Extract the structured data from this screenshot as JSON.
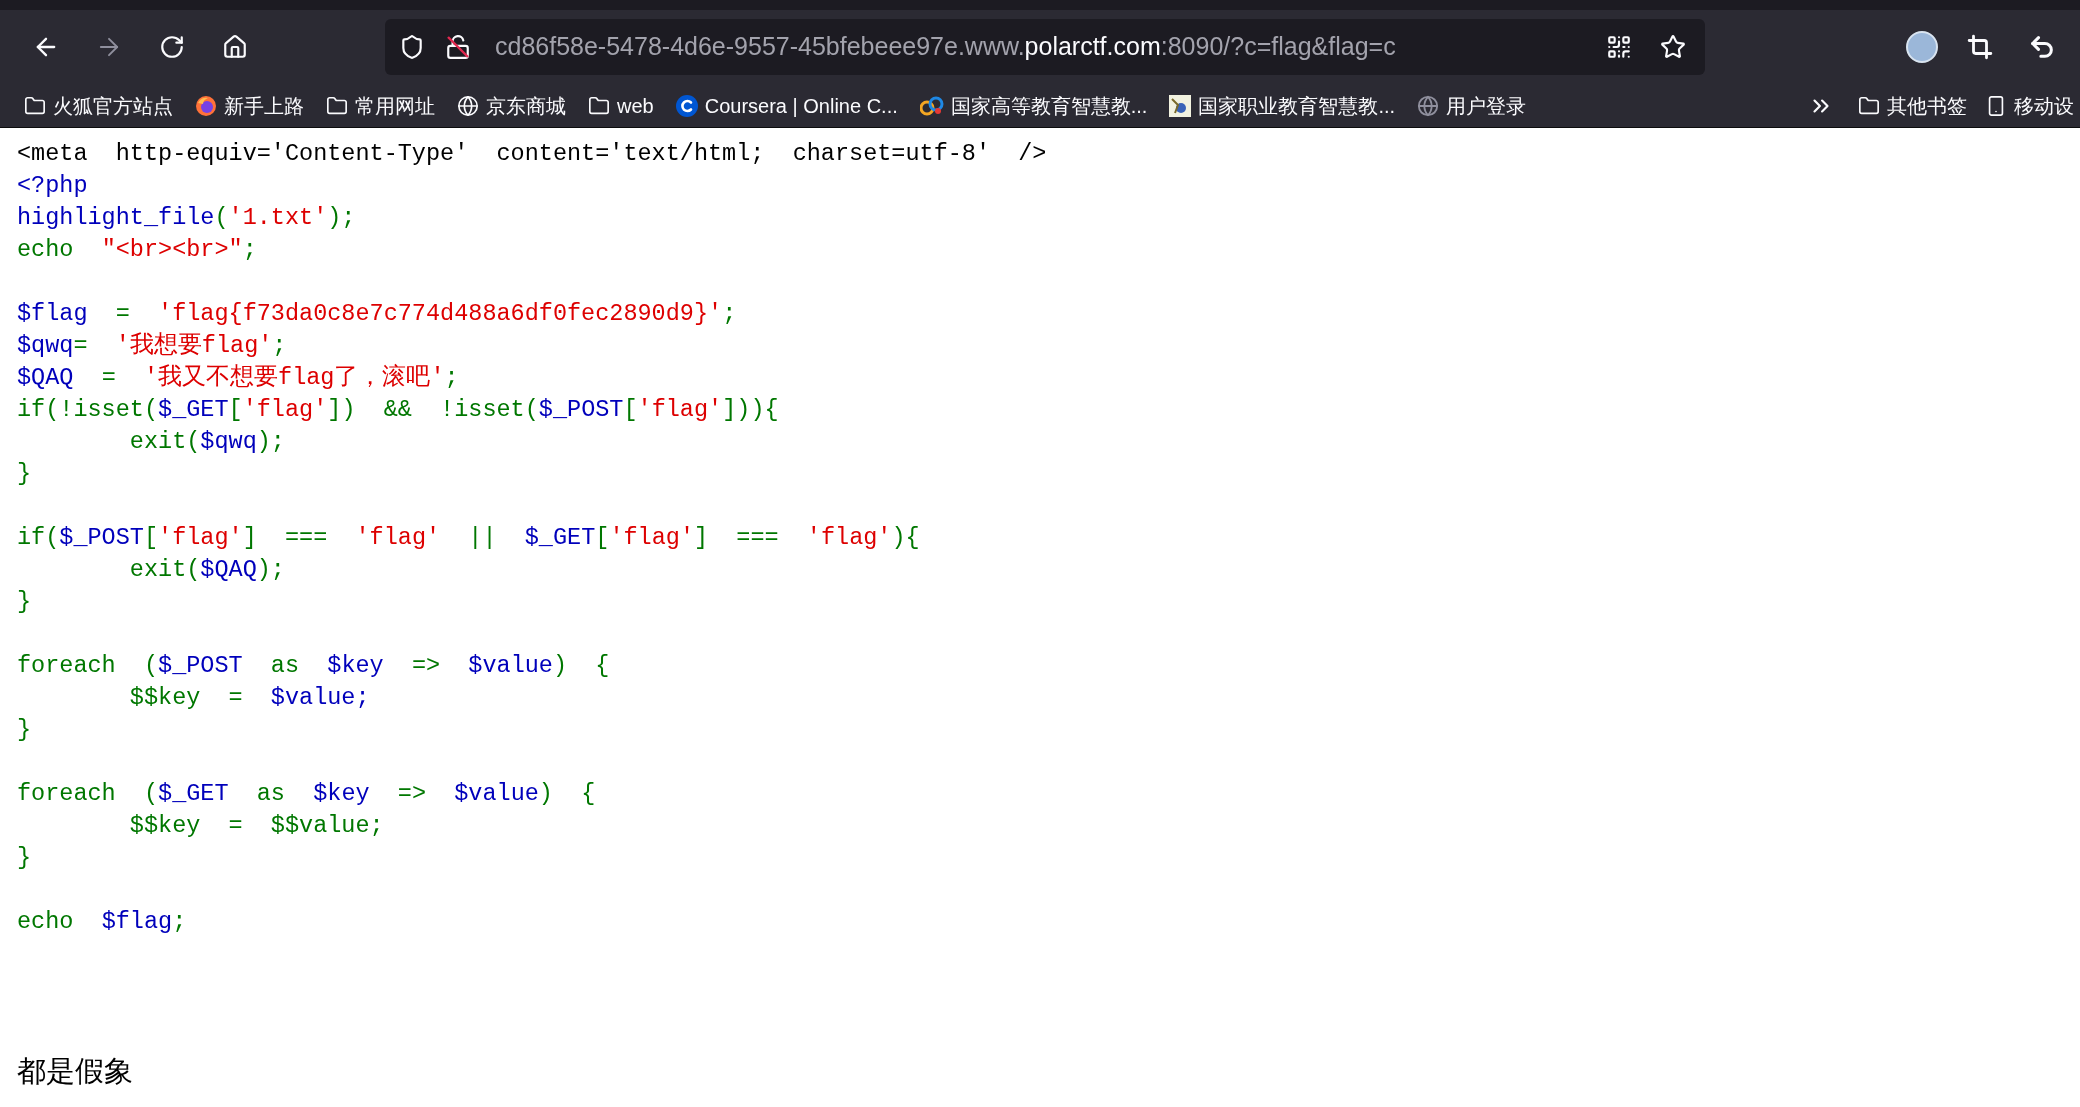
{
  "toolbar": {
    "url_parts": [
      {
        "text": "cd86f58e-5478-4d6e-9557-45bfebeee97e.www.",
        "emphasized": false
      },
      {
        "text": "polarctf.com",
        "emphasized": true
      },
      {
        "text": ":8090/?c=flag&flag=c",
        "emphasized": false
      }
    ]
  },
  "bookmarks": [
    {
      "label": "火狐官方站点",
      "kind": "folder"
    },
    {
      "label": "新手上路",
      "kind": "firefox"
    },
    {
      "label": "常用网址",
      "kind": "folder"
    },
    {
      "label": "京东商城",
      "kind": "globe"
    },
    {
      "label": "web",
      "kind": "folder"
    },
    {
      "label": "Coursera | Online C...",
      "kind": "coursera"
    },
    {
      "label": "国家高等教育智慧教...",
      "kind": "logo"
    },
    {
      "label": "国家职业教育智慧教...",
      "kind": "image"
    },
    {
      "label": "用户登录",
      "kind": "site"
    }
  ],
  "bookmarks_right": [
    {
      "label": "其他书签",
      "kind": "folder"
    },
    {
      "label": "移动设",
      "kind": "mobile"
    }
  ],
  "code_lines": [
    {
      "kind": "code",
      "tokens": [
        {
          "text": "<meta  http-equiv='Content-Type'  content='text/html;  charset=utf-8'  />",
          "color": "#000000"
        }
      ]
    },
    {
      "kind": "code",
      "tokens": [
        {
          "text": "<?php",
          "color": "#0000bb"
        }
      ]
    },
    {
      "kind": "code",
      "tokens": [
        {
          "text": "highlight_file",
          "color": "#0000bb"
        },
        {
          "text": "(",
          "color": "#007700"
        },
        {
          "text": "'1.txt'",
          "color": "#dd0000"
        },
        {
          "text": ");",
          "color": "#007700"
        }
      ]
    },
    {
      "kind": "code",
      "tokens": [
        {
          "text": "echo  ",
          "color": "#007700"
        },
        {
          "text": "\"<br><br>\"",
          "color": "#dd0000"
        },
        {
          "text": ";",
          "color": "#007700"
        }
      ]
    },
    {
      "kind": "blank"
    },
    {
      "kind": "code",
      "tokens": [
        {
          "text": "$flag  ",
          "color": "#0000bb"
        },
        {
          "text": "=  ",
          "color": "#007700"
        },
        {
          "text": "'flag{f73da0c8e7c774d488a6df0fec2890d9}'",
          "color": "#dd0000"
        },
        {
          "text": ";",
          "color": "#007700"
        }
      ]
    },
    {
      "kind": "code",
      "tokens": [
        {
          "text": "$qwq",
          "color": "#0000bb"
        },
        {
          "text": "=  ",
          "color": "#007700"
        },
        {
          "text": "'我想要flag'",
          "color": "#dd0000"
        },
        {
          "text": ";",
          "color": "#007700"
        }
      ]
    },
    {
      "kind": "code",
      "tokens": [
        {
          "text": "$QAQ  ",
          "color": "#0000bb"
        },
        {
          "text": "=  ",
          "color": "#007700"
        },
        {
          "text": "'我又不想要flag了，滚吧'",
          "color": "#dd0000"
        },
        {
          "text": ";",
          "color": "#007700"
        }
      ]
    },
    {
      "kind": "code",
      "tokens": [
        {
          "text": "if(!isset(",
          "color": "#007700"
        },
        {
          "text": "$_GET",
          "color": "#0000bb"
        },
        {
          "text": "[",
          "color": "#007700"
        },
        {
          "text": "'flag'",
          "color": "#dd0000"
        },
        {
          "text": "])  &&  !isset(",
          "color": "#007700"
        },
        {
          "text": "$_POST",
          "color": "#0000bb"
        },
        {
          "text": "[",
          "color": "#007700"
        },
        {
          "text": "'flag'",
          "color": "#dd0000"
        },
        {
          "text": "])){",
          "color": "#007700"
        }
      ]
    },
    {
      "kind": "code",
      "tokens": [
        {
          "text": "        exit(",
          "color": "#007700"
        },
        {
          "text": "$qwq",
          "color": "#0000bb"
        },
        {
          "text": ");",
          "color": "#007700"
        }
      ]
    },
    {
      "kind": "code",
      "tokens": [
        {
          "text": "}",
          "color": "#007700"
        }
      ]
    },
    {
      "kind": "blank"
    },
    {
      "kind": "code",
      "tokens": [
        {
          "text": "if(",
          "color": "#007700"
        },
        {
          "text": "$_POST",
          "color": "#0000bb"
        },
        {
          "text": "[",
          "color": "#007700"
        },
        {
          "text": "'flag'",
          "color": "#dd0000"
        },
        {
          "text": "]  ===  ",
          "color": "#007700"
        },
        {
          "text": "'flag'",
          "color": "#dd0000"
        },
        {
          "text": "  ||  ",
          "color": "#007700"
        },
        {
          "text": "$_GET",
          "color": "#0000bb"
        },
        {
          "text": "[",
          "color": "#007700"
        },
        {
          "text": "'flag'",
          "color": "#dd0000"
        },
        {
          "text": "]  ===  ",
          "color": "#007700"
        },
        {
          "text": "'flag'",
          "color": "#dd0000"
        },
        {
          "text": "){",
          "color": "#007700"
        }
      ]
    },
    {
      "kind": "code",
      "tokens": [
        {
          "text": "        exit(",
          "color": "#007700"
        },
        {
          "text": "$QAQ",
          "color": "#0000bb"
        },
        {
          "text": ");",
          "color": "#007700"
        }
      ]
    },
    {
      "kind": "code",
      "tokens": [
        {
          "text": "}",
          "color": "#007700"
        }
      ]
    },
    {
      "kind": "blank"
    },
    {
      "kind": "code",
      "tokens": [
        {
          "text": "foreach  (",
          "color": "#007700"
        },
        {
          "text": "$_POST  ",
          "color": "#0000bb"
        },
        {
          "text": "as  ",
          "color": "#007700"
        },
        {
          "text": "$key  ",
          "color": "#0000bb"
        },
        {
          "text": "=>  ",
          "color": "#007700"
        },
        {
          "text": "$value",
          "color": "#0000bb"
        },
        {
          "text": ")  {",
          "color": "#007700"
        }
      ]
    },
    {
      "kind": "code",
      "tokens": [
        {
          "text": "        $$key  =  ",
          "color": "#007700"
        },
        {
          "text": "$value;",
          "color": "#0000bb"
        }
      ]
    },
    {
      "kind": "code",
      "tokens": [
        {
          "text": "}",
          "color": "#007700"
        }
      ]
    },
    {
      "kind": "blank"
    },
    {
      "kind": "code",
      "tokens": [
        {
          "text": "foreach  (",
          "color": "#007700"
        },
        {
          "text": "$_GET  ",
          "color": "#0000bb"
        },
        {
          "text": "as  ",
          "color": "#007700"
        },
        {
          "text": "$key  ",
          "color": "#0000bb"
        },
        {
          "text": "=>  ",
          "color": "#007700"
        },
        {
          "text": "$value",
          "color": "#0000bb"
        },
        {
          "text": ")  {",
          "color": "#007700"
        }
      ]
    },
    {
      "kind": "code",
      "tokens": [
        {
          "text": "        $$key  =  $$value;",
          "color": "#007700"
        }
      ]
    },
    {
      "kind": "code",
      "tokens": [
        {
          "text": "}",
          "color": "#007700"
        }
      ]
    },
    {
      "kind": "blank"
    },
    {
      "kind": "code",
      "tokens": [
        {
          "text": "echo  ",
          "color": "#007700"
        },
        {
          "text": "$flag",
          "color": "#0000bb"
        },
        {
          "text": ";",
          "color": "#007700"
        }
      ]
    }
  ],
  "page_text": "都是假象"
}
